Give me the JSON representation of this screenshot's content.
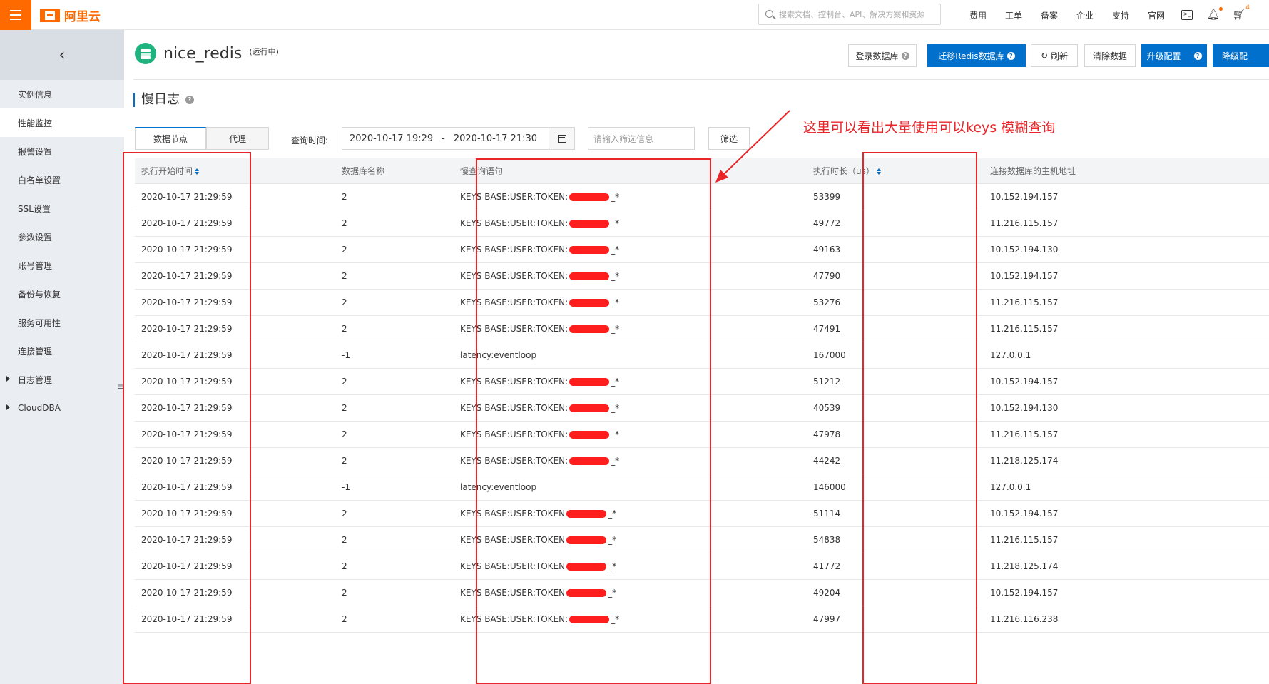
{
  "topbar": {
    "logo_text": "阿里云",
    "search_placeholder": "搜索文档、控制台、API、解决方案和资源",
    "links": [
      "费用",
      "工单",
      "备案",
      "企业",
      "支持",
      "官网"
    ],
    "cart_count": "4"
  },
  "sidebar": {
    "items": [
      {
        "label": "实例信息"
      },
      {
        "label": "性能监控"
      },
      {
        "label": "报警设置"
      },
      {
        "label": "白名单设置"
      },
      {
        "label": "SSL设置"
      },
      {
        "label": "参数设置"
      },
      {
        "label": "账号管理"
      },
      {
        "label": "备份与恢复"
      },
      {
        "label": "服务可用性"
      },
      {
        "label": "连接管理"
      },
      {
        "label": "日志管理"
      },
      {
        "label": "CloudDBA"
      }
    ],
    "collapse_glyph": "≡"
  },
  "instance": {
    "name": "nice_redis",
    "status": "(运行中)"
  },
  "actions": {
    "login_db": "登录数据库",
    "migrate": "迁移Redis数据库",
    "refresh": "刷新",
    "clear": "清除数据",
    "upgrade": "升级配置",
    "downgrade": "降级配"
  },
  "section": {
    "title": "慢日志"
  },
  "tabs": [
    "数据节点",
    "代理"
  ],
  "query": {
    "label": "查询时间:",
    "start": "2020-10-17 19:29",
    "sep": "-",
    "end": "2020-10-17 21:30",
    "filter_placeholder": "请输入筛选信息",
    "filter_button": "筛选"
  },
  "table": {
    "headers": [
      "执行开始时间",
      "数据库名称",
      "慢查询语句",
      "执行时长（us）",
      "连接数据库的主机地址"
    ],
    "rows": [
      {
        "time": "2020-10-17 21:29:59",
        "db": "2",
        "cmd": "KEYS BASE:USER:TOKEN:",
        "suffix": "_*",
        "redacted": true,
        "dur": "53399",
        "host": "10.152.194.157"
      },
      {
        "time": "2020-10-17 21:29:59",
        "db": "2",
        "cmd": "KEYS BASE:USER:TOKEN:",
        "suffix": "_*",
        "redacted": true,
        "dur": "49772",
        "host": "11.216.115.157"
      },
      {
        "time": "2020-10-17 21:29:59",
        "db": "2",
        "cmd": "KEYS BASE:USER:TOKEN:",
        "suffix": "_*",
        "redacted": true,
        "dur": "49163",
        "host": "10.152.194.130"
      },
      {
        "time": "2020-10-17 21:29:59",
        "db": "2",
        "cmd": "KEYS BASE:USER:TOKEN:",
        "suffix": "_*",
        "redacted": true,
        "dur": "47790",
        "host": "10.152.194.157"
      },
      {
        "time": "2020-10-17 21:29:59",
        "db": "2",
        "cmd": "KEYS BASE:USER:TOKEN:",
        "suffix": "_*",
        "redacted": true,
        "dur": "53276",
        "host": "11.216.115.157"
      },
      {
        "time": "2020-10-17 21:29:59",
        "db": "2",
        "cmd": "KEYS BASE:USER:TOKEN:",
        "suffix": "_*",
        "redacted": true,
        "dur": "47491",
        "host": "11.216.115.157"
      },
      {
        "time": "2020-10-17 21:29:59",
        "db": "-1",
        "cmd": "latency:eventloop",
        "suffix": "",
        "redacted": false,
        "dur": "167000",
        "host": "127.0.0.1"
      },
      {
        "time": "2020-10-17 21:29:59",
        "db": "2",
        "cmd": "KEYS BASE:USER:TOKEN:",
        "suffix": "_*",
        "redacted": true,
        "dur": "51212",
        "host": "10.152.194.157"
      },
      {
        "time": "2020-10-17 21:29:59",
        "db": "2",
        "cmd": "KEYS BASE:USER:TOKEN:",
        "suffix": "_*",
        "redacted": true,
        "dur": "40539",
        "host": "10.152.194.130"
      },
      {
        "time": "2020-10-17 21:29:59",
        "db": "2",
        "cmd": "KEYS BASE:USER:TOKEN:",
        "suffix": "_*",
        "redacted": true,
        "dur": "47978",
        "host": "11.216.115.157"
      },
      {
        "time": "2020-10-17 21:29:59",
        "db": "2",
        "cmd": "KEYS BASE:USER:TOKEN:",
        "suffix": "_*",
        "redacted": true,
        "dur": "44242",
        "host": "11.218.125.174"
      },
      {
        "time": "2020-10-17 21:29:59",
        "db": "-1",
        "cmd": "latency:eventloop",
        "suffix": "",
        "redacted": false,
        "dur": "146000",
        "host": "127.0.0.1"
      },
      {
        "time": "2020-10-17 21:29:59",
        "db": "2",
        "cmd": "KEYS BASE:USER:TOKEN",
        "suffix": "_*",
        "redacted": true,
        "dur": "51114",
        "host": "10.152.194.157"
      },
      {
        "time": "2020-10-17 21:29:59",
        "db": "2",
        "cmd": "KEYS BASE:USER:TOKEN",
        "suffix": "_*",
        "redacted": true,
        "dur": "54838",
        "host": "11.216.115.157"
      },
      {
        "time": "2020-10-17 21:29:59",
        "db": "2",
        "cmd": "KEYS BASE:USER:TOKEN",
        "suffix": "_*",
        "redacted": true,
        "dur": "41772",
        "host": "11.218.125.174"
      },
      {
        "time": "2020-10-17 21:29:59",
        "db": "2",
        "cmd": "KEYS BASE:USER:TOKEN",
        "suffix": "_*",
        "redacted": true,
        "dur": "49204",
        "host": "10.152.194.157"
      },
      {
        "time": "2020-10-17 21:29:59",
        "db": "2",
        "cmd": "KEYS BASE:USER:TOKEN:",
        "suffix": "_*",
        "redacted": true,
        "dur": "47997",
        "host": "11.216.116.238"
      }
    ]
  },
  "annotation": {
    "text": "这里可以看出大量使用可以keys 模糊查询",
    "color": "#e8262a"
  },
  "colors": {
    "brand": "#ff6a00",
    "primary": "#0070cc"
  }
}
